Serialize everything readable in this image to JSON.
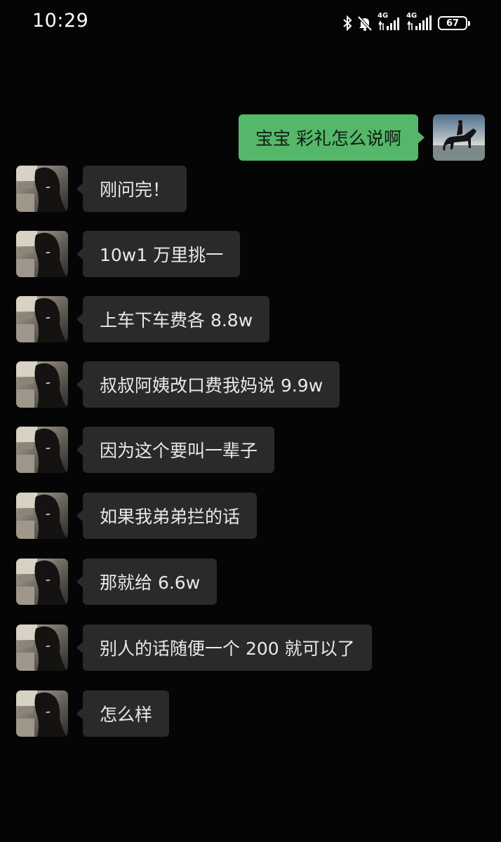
{
  "status_bar": {
    "time": "10:29",
    "network_1": "4G",
    "network_2": "4G",
    "battery": "67",
    "icons": [
      "bluetooth-icon",
      "mute-bell-icon",
      "signal-4g-icon",
      "signal-4g-icon",
      "battery-icon"
    ]
  },
  "colors": {
    "background": "#050505",
    "incoming_bubble": "#2a2a2a",
    "outgoing_bubble": "#55b76a"
  },
  "messages": [
    {
      "from": "me",
      "text": "宝宝 彩礼怎么说啊"
    },
    {
      "from": "other",
      "text": "刚问完！"
    },
    {
      "from": "other",
      "text": "10w1 万里挑一"
    },
    {
      "from": "other",
      "text": "上车下车费各 8.8w"
    },
    {
      "from": "other",
      "text": "叔叔阿姨改口费我妈说 9.9w"
    },
    {
      "from": "other",
      "text": "因为这个要叫一辈子"
    },
    {
      "from": "other",
      "text": "如果我弟弟拦的话"
    },
    {
      "from": "other",
      "text": "那就给 6.6w"
    },
    {
      "from": "other",
      "text": "别人的话随便一个 200 就可以了"
    },
    {
      "from": "other",
      "text": "怎么样"
    }
  ]
}
